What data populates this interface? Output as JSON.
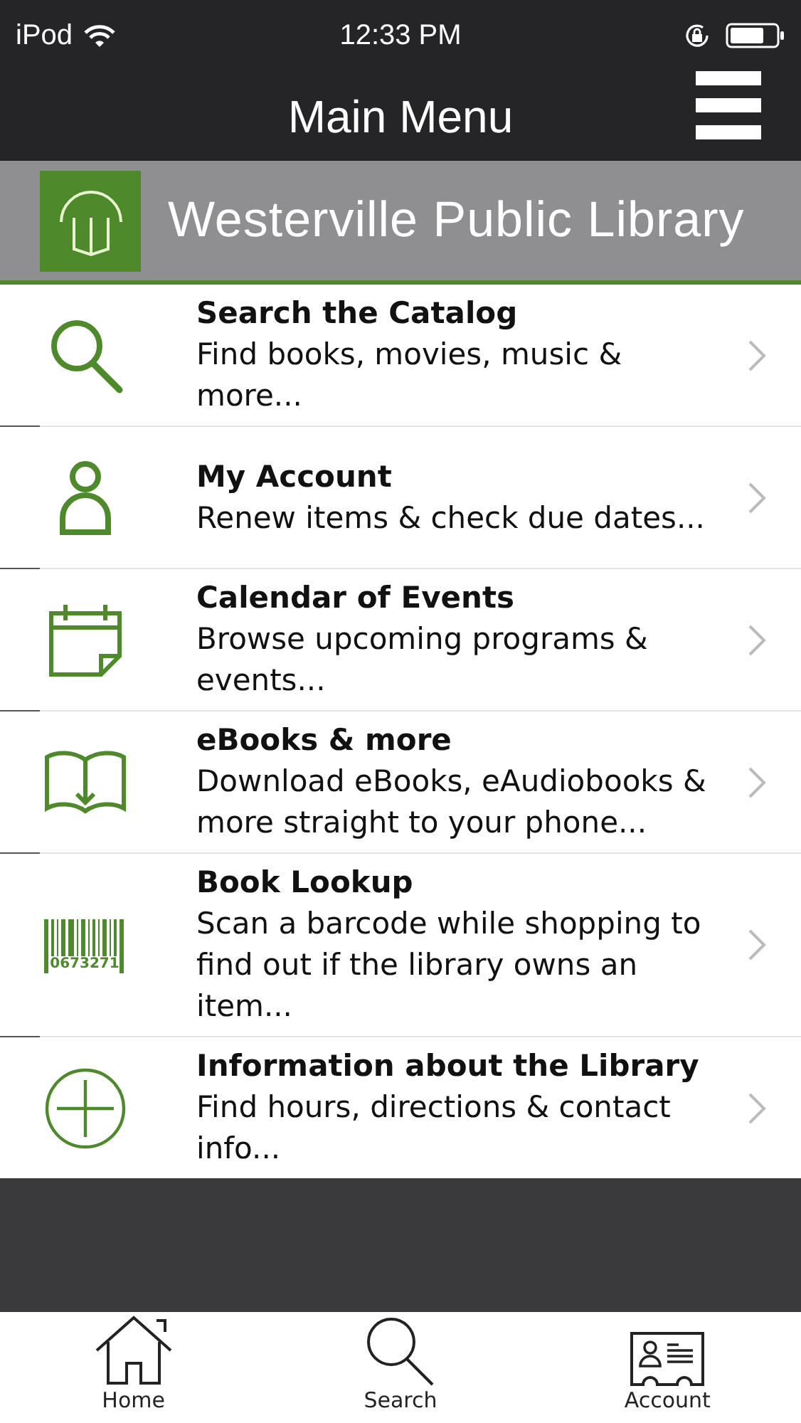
{
  "status_bar": {
    "carrier": "iPod",
    "time": "12:33 PM"
  },
  "nav_bar": {
    "title": "Main Menu"
  },
  "banner": {
    "title": "Westerville Public Library"
  },
  "menu_items": [
    {
      "kind": "search",
      "title": "Search the Catalog",
      "description": "Find books, movies, music & more..."
    },
    {
      "kind": "account",
      "title": "My Account",
      "description": "Renew items & check due dates..."
    },
    {
      "kind": "calendar",
      "title": "Calendar of Events",
      "description": "Browse upcoming programs & events..."
    },
    {
      "kind": "ebook",
      "title": "eBooks & more",
      "description": "Download eBooks, eAudiobooks & more straight to your phone..."
    },
    {
      "kind": "barcode",
      "title": "Book Lookup",
      "description": "Scan a barcode while shopping to find out if the library owns an item...",
      "icon_text": "0673271"
    },
    {
      "kind": "info",
      "title": "Information about the Library",
      "description": "Find hours, directions & contact info..."
    }
  ],
  "tab_bar": [
    {
      "kind": "home",
      "label": "Home"
    },
    {
      "kind": "search",
      "label": "Search"
    },
    {
      "kind": "account",
      "label": "Account"
    }
  ]
}
